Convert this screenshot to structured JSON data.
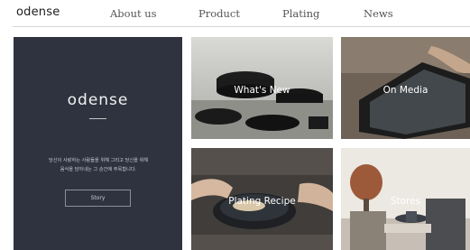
{
  "header": {
    "logo": "odense",
    "nav": [
      "About us",
      "Product",
      "Plating",
      "News"
    ]
  },
  "brand_panel": {
    "name": "odense",
    "tagline_line1": "당신이 사랑하는 사람들을 위해 그리고 당신을 위해",
    "tagline_line2": "음식을 담아내는 그 순간에 주목합니다.",
    "story_button": "Story",
    "background_color": "#2f3340"
  },
  "tiles": {
    "whats_new": "What's New",
    "on_media": "On Media",
    "plating_recipe": "Plating Recipe",
    "stores": "Stores"
  }
}
